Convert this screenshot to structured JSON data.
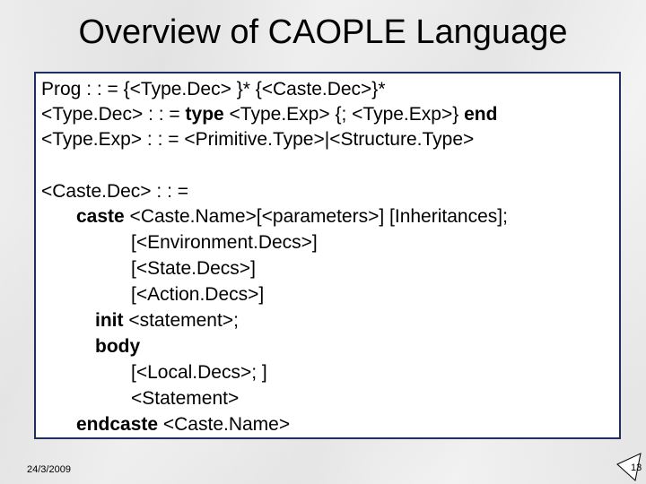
{
  "slide": {
    "title": "Overview of CAOPLE Language",
    "date": "24/3/2009",
    "page_number": "13"
  },
  "grammar": {
    "l1": "Prog : : = {<Type.Dec> }* {<Caste.Dec>}*",
    "l2_pre": "<Type.Dec> : : = ",
    "l2_kw1": "type",
    "l2_mid": " <Type.Exp> {; <Type.Exp>} ",
    "l2_kw2": "end",
    "l3": "<Type.Exp> : : = <Primitive.Type>|<Structure.Type>",
    "l4": "<Caste.Dec> : : =",
    "l5_kw": "caste",
    "l5_rest": " <Caste.Name>[<parameters>] [Inheritances];",
    "l6": "[<Environment.Decs>]",
    "l7": "[<State.Decs>]",
    "l8": "[<Action.Decs>]",
    "l9_kw": "init",
    "l9_rest": " <statement>;",
    "l10_kw": "body",
    "l11": "[<Local.Decs>; ]",
    "l12": "<Statement>",
    "l13_kw": "endcaste",
    "l13_rest": " <Caste.Name>"
  }
}
